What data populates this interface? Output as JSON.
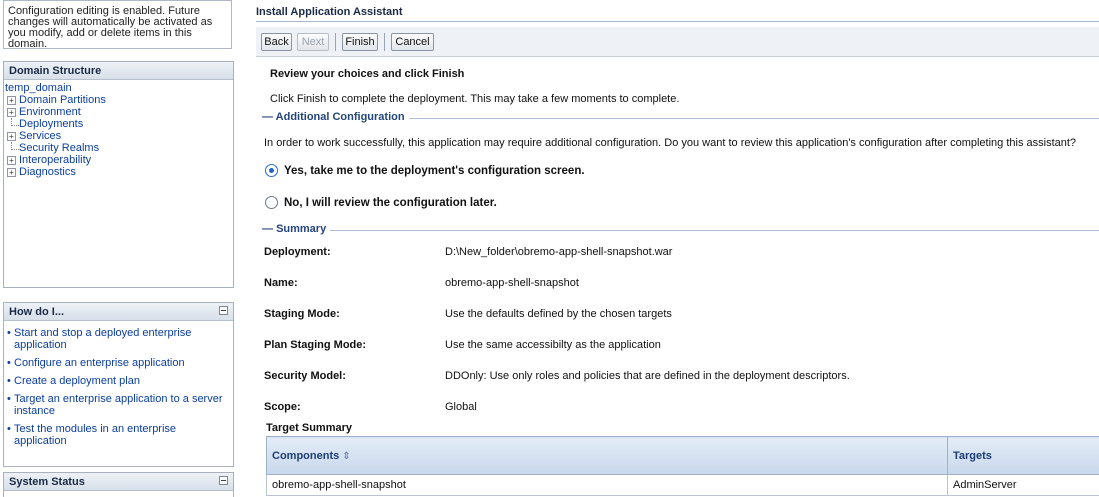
{
  "left": {
    "change_center_text": "Configuration editing is enabled. Future changes will automatically be activated as you modify, add or delete items in this domain.",
    "domain_structure": {
      "title": "Domain Structure",
      "root": "temp_domain",
      "items": [
        {
          "label": "Domain Partitions",
          "expandable": true
        },
        {
          "label": "Environment",
          "expandable": true
        },
        {
          "label": "Deployments",
          "expandable": false
        },
        {
          "label": "Services",
          "expandable": true
        },
        {
          "label": "Security Realms",
          "expandable": false
        },
        {
          "label": "Interoperability",
          "expandable": true
        },
        {
          "label": "Diagnostics",
          "expandable": true
        }
      ]
    },
    "how_do_i": {
      "title": "How do I...",
      "links": [
        "Start and stop a deployed enterprise application",
        "Configure an enterprise application",
        "Create a deployment plan",
        "Target an enterprise application to a server instance",
        "Test the modules in an enterprise application"
      ]
    },
    "system_status": {
      "title": "System Status"
    }
  },
  "main": {
    "title": "Install Application Assistant",
    "buttons": {
      "back": "Back",
      "next": "Next",
      "finish": "Finish",
      "cancel": "Cancel"
    },
    "heading": "Review your choices and click Finish",
    "intro": "Click Finish to complete the deployment. This may take a few moments to complete.",
    "additional_config": {
      "section_label": "Additional Configuration",
      "text": "In order to work successfully, this application may require additional configuration. Do you want to review this application's configuration after completing this assistant?",
      "options": [
        {
          "label": "Yes, take me to the deployment's configuration screen.",
          "selected": true
        },
        {
          "label": "No, I will review the configuration later.",
          "selected": false
        }
      ]
    },
    "summary": {
      "section_label": "Summary",
      "rows": [
        {
          "label": "Deployment:",
          "value": "D:\\New_folder\\obremo-app-shell-snapshot.war"
        },
        {
          "label": "Name:",
          "value": "obremo-app-shell-snapshot"
        },
        {
          "label": "Staging Mode:",
          "value": "Use the defaults defined by the chosen targets"
        },
        {
          "label": "Plan Staging Mode:",
          "value": "Use the same accessibilty as the application"
        },
        {
          "label": "Security Model:",
          "value": "DDOnly: Use only roles and policies that are defined in the deployment descriptors."
        },
        {
          "label": "Scope:",
          "value": "Global"
        }
      ]
    },
    "target_summary": {
      "title": "Target Summary",
      "columns": [
        "Components",
        "Targets"
      ],
      "rows": [
        [
          "obremo-app-shell-snapshot",
          "AdminServer"
        ]
      ]
    }
  },
  "colors": {
    "link": "#0b3e9c",
    "section_label": "#24457a",
    "radio_selected": "#1f63cc",
    "table_header": "#c9d8ec"
  },
  "icons": {
    "expand": "plus-box-icon",
    "collapse": "minus-box-icon",
    "sort": "sort-icon"
  }
}
